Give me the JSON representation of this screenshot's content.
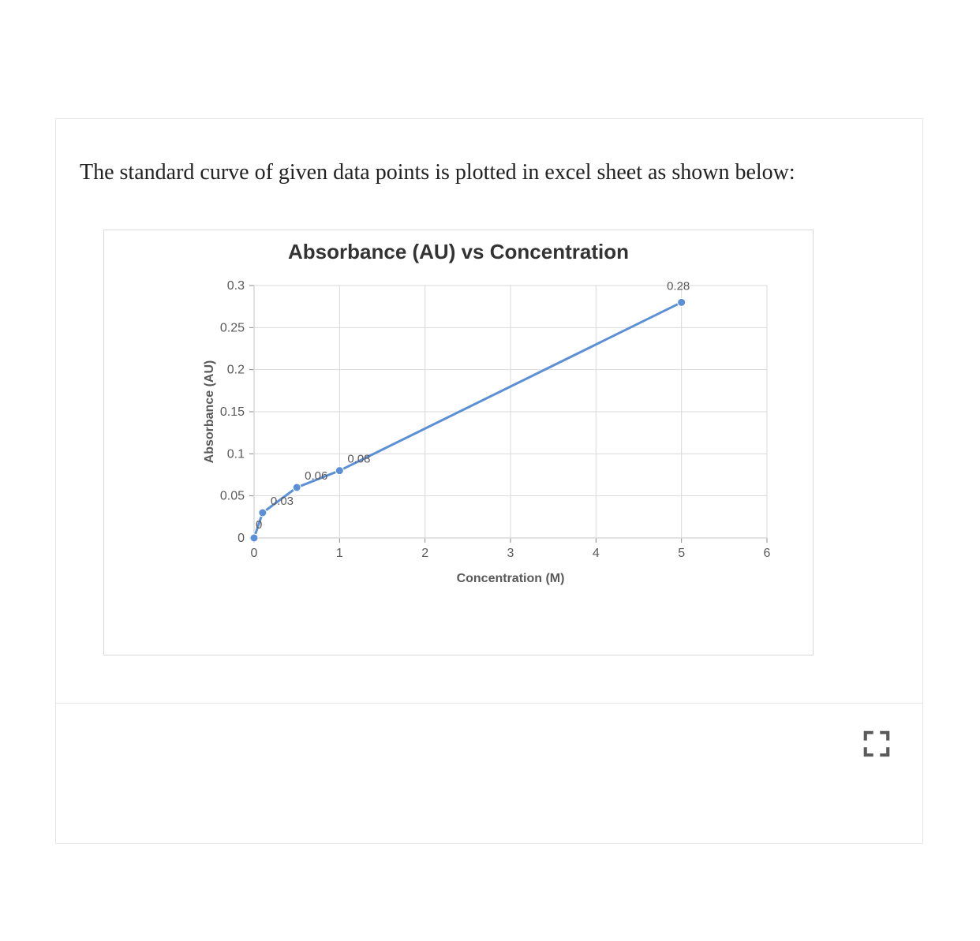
{
  "caption": "The standard curve of given data points is plotted in excel sheet as shown below:",
  "chart_data": {
    "type": "line",
    "title": "Absorbance (AU) vs Concentration",
    "xlabel": "Concentration (M)",
    "ylabel": "Absorbance (AU)",
    "xlim": [
      0,
      6
    ],
    "ylim": [
      0,
      0.3
    ],
    "x_ticks": [
      0,
      1,
      2,
      3,
      4,
      5,
      6
    ],
    "y_ticks": [
      0,
      0.05,
      0.1,
      0.15,
      0.2,
      0.25,
      0.3
    ],
    "x": [
      0,
      0.1,
      0.5,
      1,
      5
    ],
    "values": [
      0,
      0.03,
      0.06,
      0.08,
      0.28
    ],
    "data_labels": [
      "0",
      "0.03",
      "0.06",
      "0.08",
      "0.28"
    ],
    "line_color": "#5b8fd6",
    "marker_color": "#5b8fd6",
    "grid": true
  },
  "fullscreen_button": {
    "label": "Fullscreen"
  }
}
